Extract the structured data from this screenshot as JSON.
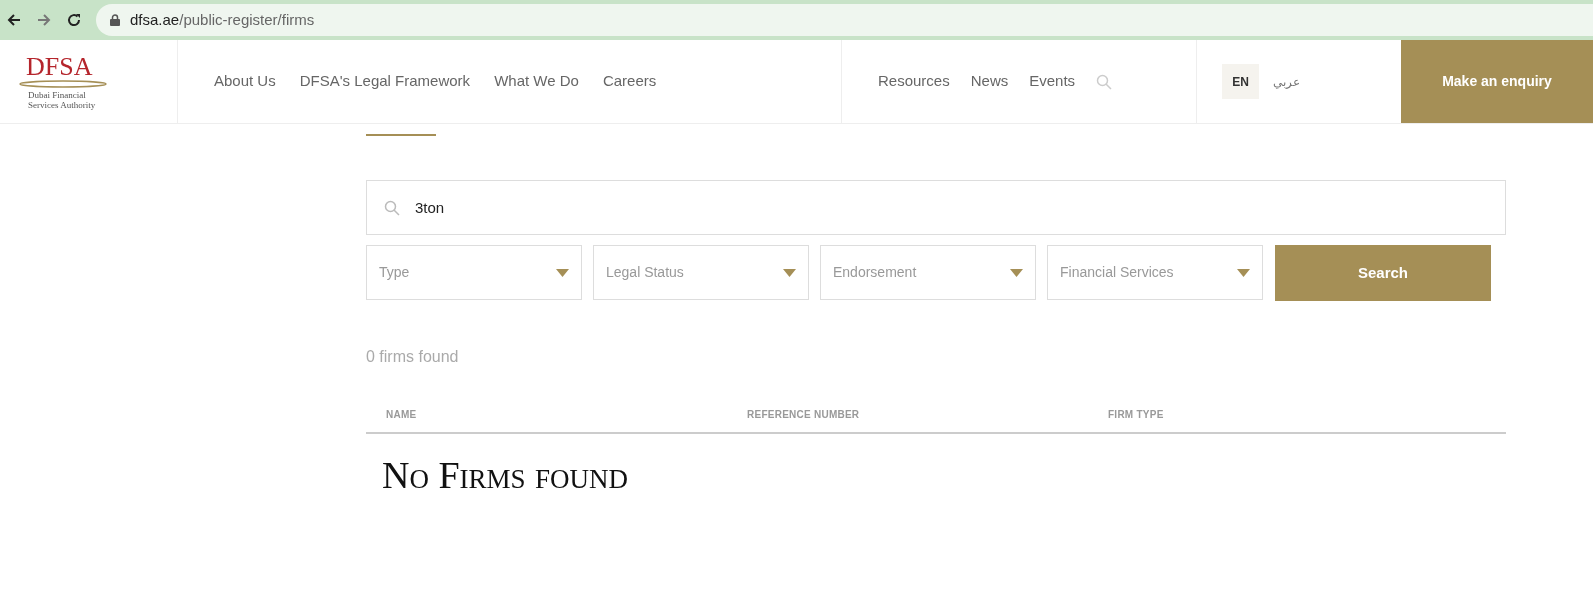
{
  "browser": {
    "url_host": "dfsa.ae",
    "url_path": "/public-register/firms"
  },
  "logo": {
    "mark": "DFSA",
    "subtitle": "Dubai Financial Services Authority"
  },
  "nav_main": [
    "About Us",
    "DFSA's Legal Framework",
    "What We Do",
    "Careers"
  ],
  "nav_secondary": [
    "Resources",
    "News",
    "Events"
  ],
  "languages": [
    {
      "label": "EN",
      "selected": true
    },
    {
      "label": "عربي",
      "selected": false
    }
  ],
  "enquiry_button": "Make an enquiry",
  "search": {
    "value": "3ton"
  },
  "filters": [
    {
      "placeholder": "Type"
    },
    {
      "placeholder": "Legal Status"
    },
    {
      "placeholder": "Endorsement"
    },
    {
      "placeholder": "Financial Services"
    }
  ],
  "search_button": "Search",
  "result_count": "0 firms found",
  "table": {
    "columns": [
      "NAME",
      "REFERENCE NUMBER",
      "FIRM TYPE"
    ],
    "empty_message": "No Firms found"
  }
}
